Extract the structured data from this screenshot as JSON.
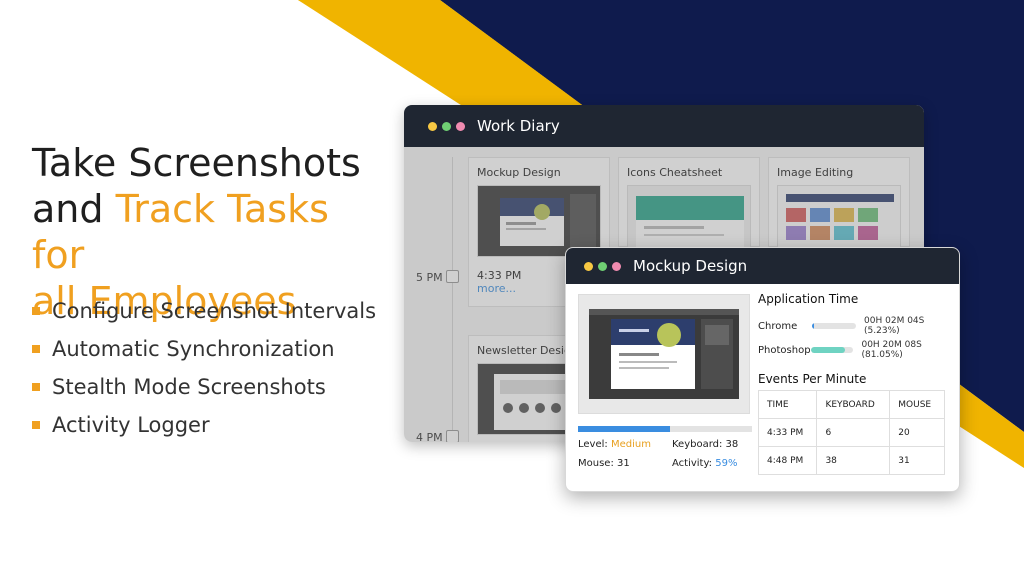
{
  "headline": {
    "line1": "Take Screenshots",
    "line2_plain": "and ",
    "line2_accent": "Track Tasks for",
    "line3_accent": "all Employees"
  },
  "bullets": [
    "Configure Screenshot Intervals",
    "Automatic Synchronization",
    "Stealth Mode Screenshots",
    "Activity Logger"
  ],
  "colors": {
    "accent": "#f0a020",
    "navy": "#0f1b4d",
    "yellow": "#f0b400",
    "titlebar": "#1f2632",
    "link_blue": "#3a8de0",
    "teal": "#6fd3c2"
  },
  "work_diary": {
    "title": "Work Diary",
    "time_labels": [
      "5 PM",
      "4 PM"
    ],
    "cards": [
      {
        "title": "Mockup Design",
        "time": "4:33 PM",
        "more": "more..."
      },
      {
        "title": "Icons Cheatsheet"
      },
      {
        "title": "Image Editing"
      },
      {
        "title": "Newsletter Design"
      }
    ]
  },
  "popup": {
    "title": "Mockup Design",
    "activity_progress": 0.53,
    "level_label": "Level:",
    "level_value": "Medium",
    "keyboard_label": "Keyboard: 38",
    "mouse_label": "Mouse: 31",
    "activity_label": "Activity:",
    "activity_value": "59%",
    "application_time_title": "Application Time",
    "apps": [
      {
        "name": "Chrome",
        "value": "00H 02M 04S (5.23%)",
        "fraction": 0.0523,
        "color": "#3a8de0"
      },
      {
        "name": "Photoshop",
        "value": "00H 20M 08S (81.05%)",
        "fraction": 0.8105,
        "color": "#6fd3c2"
      }
    ],
    "events_title": "Events Per Minute",
    "events_headers": [
      "TIME",
      "KEYBOARD",
      "MOUSE"
    ],
    "events_rows": [
      [
        "4:33 PM",
        "6",
        "20"
      ],
      [
        "4:48 PM",
        "38",
        "31"
      ]
    ]
  }
}
